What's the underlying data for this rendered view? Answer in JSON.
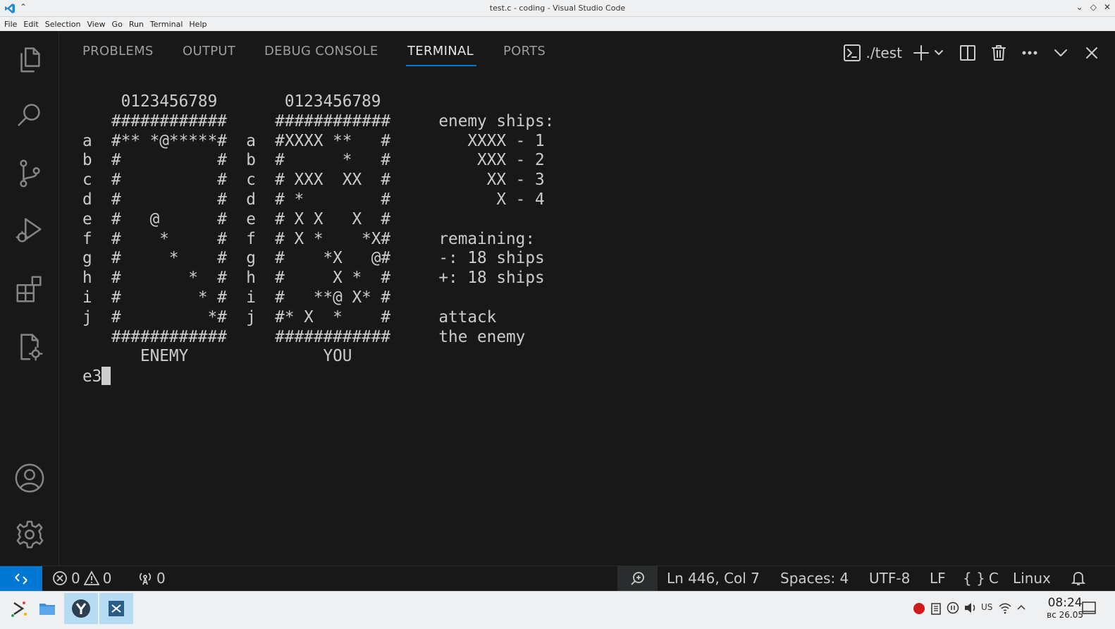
{
  "window": {
    "title": "test.c - coding - Visual Studio Code"
  },
  "menu": [
    "File",
    "Edit",
    "Selection",
    "View",
    "Go",
    "Run",
    "Terminal",
    "Help"
  ],
  "activity_bar": [
    {
      "name": "explorer-icon"
    },
    {
      "name": "search-icon"
    },
    {
      "name": "source-control-icon"
    },
    {
      "name": "run-debug-icon"
    },
    {
      "name": "extensions-icon"
    },
    {
      "name": "remote-settings-icon"
    },
    {
      "name": "account-icon"
    },
    {
      "name": "gear-icon"
    }
  ],
  "panel": {
    "tabs": [
      "PROBLEMS",
      "OUTPUT",
      "DEBUG CONSOLE",
      "TERMINAL",
      "PORTS"
    ],
    "active_tab": "TERMINAL",
    "terminal_name": "./test"
  },
  "terminal": {
    "lines": [
      "    0123456789       0123456789",
      "   ############     ############     enemy ships:",
      "a  #** *@*****#  a  #XXXX **   #        XXXX - 1",
      "b  #          #  b  #      *   #         XXX - 2",
      "c  #          #  c  # XXX  XX  #          XX - 3",
      "d  #          #  d  # *        #           X - 4",
      "e  #   @      #  e  # X X   X  #",
      "f  #    *     #  f  # X *    *X#     remaining:",
      "g  #     *    #  g  #    *X   @#     -: 18 ships",
      "h  #       *  #  h  #     X *  #     +: 18 ships",
      "i  #        * #  i  #   **@ X* #",
      "j  #         *#  j  #* X  *    #     attack",
      "   ############     ############     the enemy",
      "      ENEMY              YOU"
    ],
    "prompt": "e3"
  },
  "status": {
    "errors": "0",
    "warnings": "0",
    "ports": "0",
    "position": "Ln 446, Col 7",
    "spaces": "Spaces: 4",
    "encoding": "UTF-8",
    "eol": "LF",
    "language": "C",
    "language_icon": "{ }",
    "os": "Linux"
  },
  "taskbar": {
    "keyboard": "US",
    "time": "08:24",
    "date": "вс 26.05"
  },
  "colors": {
    "accent": "#0078d4",
    "background": "#181818",
    "text": "#cccccc"
  }
}
